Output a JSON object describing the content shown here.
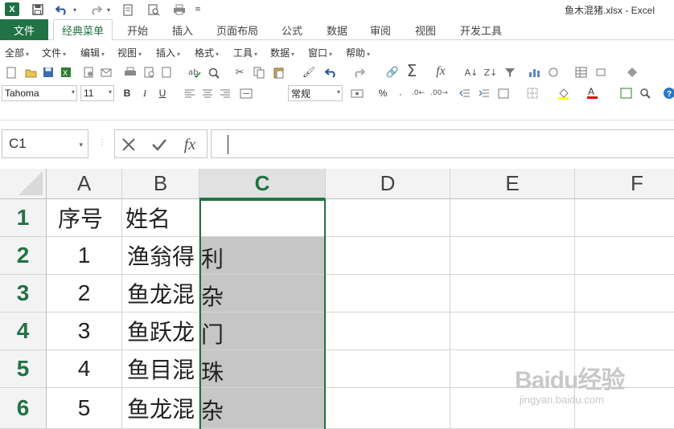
{
  "window": {
    "title": "鱼木混猪.xlsx - Excel"
  },
  "qat": {
    "logo": "X"
  },
  "ribbon_tabs": [
    "文件",
    "经典菜单",
    "开始",
    "插入",
    "页面布局",
    "公式",
    "数据",
    "审阅",
    "视图",
    "开发工具"
  ],
  "classic_menu": [
    "全部",
    "文件",
    "编辑",
    "视图",
    "插入",
    "格式",
    "工具",
    "数据",
    "窗口",
    "帮助"
  ],
  "format_toolbar": {
    "font_name": "Tahoma",
    "font_size": "11",
    "bold": "B",
    "italic": "I",
    "underline": "U",
    "number_format": "常规",
    "percent": "%"
  },
  "formula_bar": {
    "name_box": "C1",
    "fx": "fx",
    "formula": ""
  },
  "columns": [
    "A",
    "B",
    "C",
    "D",
    "E",
    "F"
  ],
  "selected_column": "C",
  "rows": [
    {
      "num": "1",
      "a": "序号",
      "b": "姓名",
      "spill": ""
    },
    {
      "num": "2",
      "a": "1",
      "b": "渔翁得",
      "spill": "利"
    },
    {
      "num": "3",
      "a": "2",
      "b": "鱼龙混",
      "spill": "杂"
    },
    {
      "num": "4",
      "a": "3",
      "b": "鱼跃龙",
      "spill": "门"
    },
    {
      "num": "5",
      "a": "4",
      "b": "鱼目混",
      "spill": "珠"
    },
    {
      "num": "6",
      "a": "5",
      "b": "鱼龙混",
      "spill": "杂"
    }
  ],
  "colors": {
    "excel_green": "#217346",
    "selection_gray": "#c6c6c6"
  },
  "watermark": {
    "main": "Baidu经验",
    "sub": "jingyan.baidu.com"
  }
}
